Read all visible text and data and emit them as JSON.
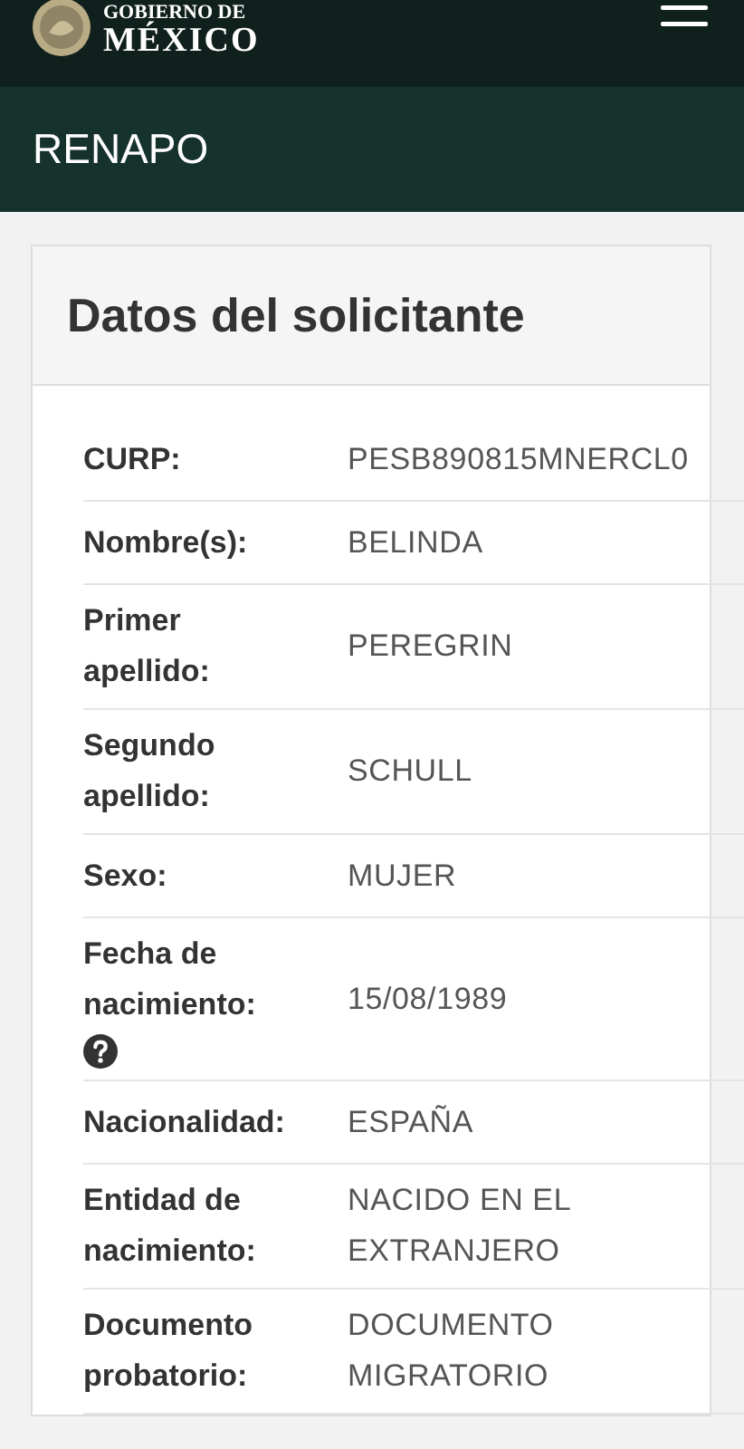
{
  "header": {
    "brand_top": "GOBIERNO DE",
    "brand_bottom": "MÉXICO"
  },
  "section_bar": {
    "title": "RENAPO"
  },
  "card": {
    "title": "Datos del solicitante",
    "rows": [
      {
        "label": "CURP:",
        "value": "PESB890815MNERCL0",
        "help": false
      },
      {
        "label": "Nombre(s):",
        "value": "BELINDA",
        "help": false
      },
      {
        "label": "Primer apellido:",
        "value": "PEREGRIN",
        "help": false
      },
      {
        "label": "Segundo apellido:",
        "value": "SCHULL",
        "help": false
      },
      {
        "label": "Sexo:",
        "value": "MUJER",
        "help": false
      },
      {
        "label": "Fecha de nacimiento:",
        "value": "15/08/1989",
        "help": true
      },
      {
        "label": "Nacionalidad:",
        "value": "ESPAÑA",
        "help": false
      },
      {
        "label": "Entidad de nacimiento:",
        "value": "NACIDO EN EL EXTRANJERO",
        "help": false
      },
      {
        "label": "Documento probatorio:",
        "value": "DOCUMENTO MIGRATORIO",
        "help": false
      }
    ]
  }
}
